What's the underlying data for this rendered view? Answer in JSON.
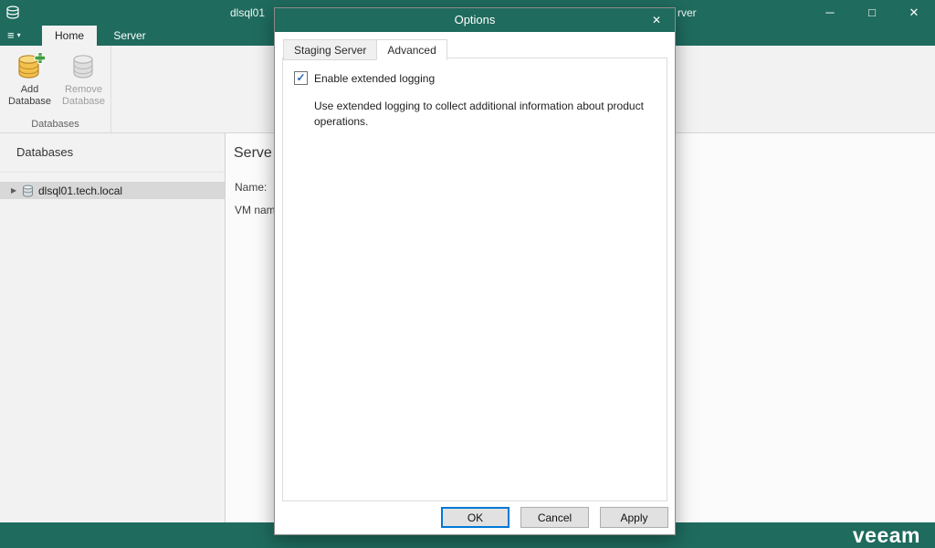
{
  "colors": {
    "teal": "#1f6b5e",
    "focus_blue": "#0078d7",
    "check_blue": "#2a66b8",
    "selection_gray": "#d8d8d8",
    "ribbon_bg": "#f2f2f2",
    "add_icon_yellow": "#f3c14b",
    "plus_green": "#3f9e3f"
  },
  "titlebar": {
    "title_fragment_left": "dlsql01",
    "title_fragment_right": "rver"
  },
  "menubar": {
    "tabs": [
      {
        "label": "Home",
        "active": true
      },
      {
        "label": "Server",
        "active": false
      }
    ]
  },
  "ribbon": {
    "add_label": "Add Database",
    "remove_label": "Remove Database",
    "group_label": "Databases"
  },
  "sidebar": {
    "header": "Databases",
    "tree_item": "dlsql01.tech.local"
  },
  "main": {
    "heading": "Serve",
    "labels": [
      "Name:",
      "VM nam"
    ]
  },
  "dialog": {
    "title": "Options",
    "tabs": [
      {
        "label": "Staging Server",
        "active": false
      },
      {
        "label": "Advanced",
        "active": true
      }
    ],
    "checkbox_checked": true,
    "checkbox_label": "Enable extended logging",
    "description": "Use extended logging to collect additional information about product operations.",
    "buttons": {
      "ok": "OK",
      "cancel": "Cancel",
      "apply": "Apply"
    }
  },
  "footer": {
    "logo": "veeam"
  },
  "icons": {
    "hamburger": "≡",
    "caret_down": "▾",
    "minimize": "─",
    "maximize": "□",
    "close": "✕",
    "dialog_close": "✕",
    "tree_expand": "▶",
    "check": "✓"
  }
}
